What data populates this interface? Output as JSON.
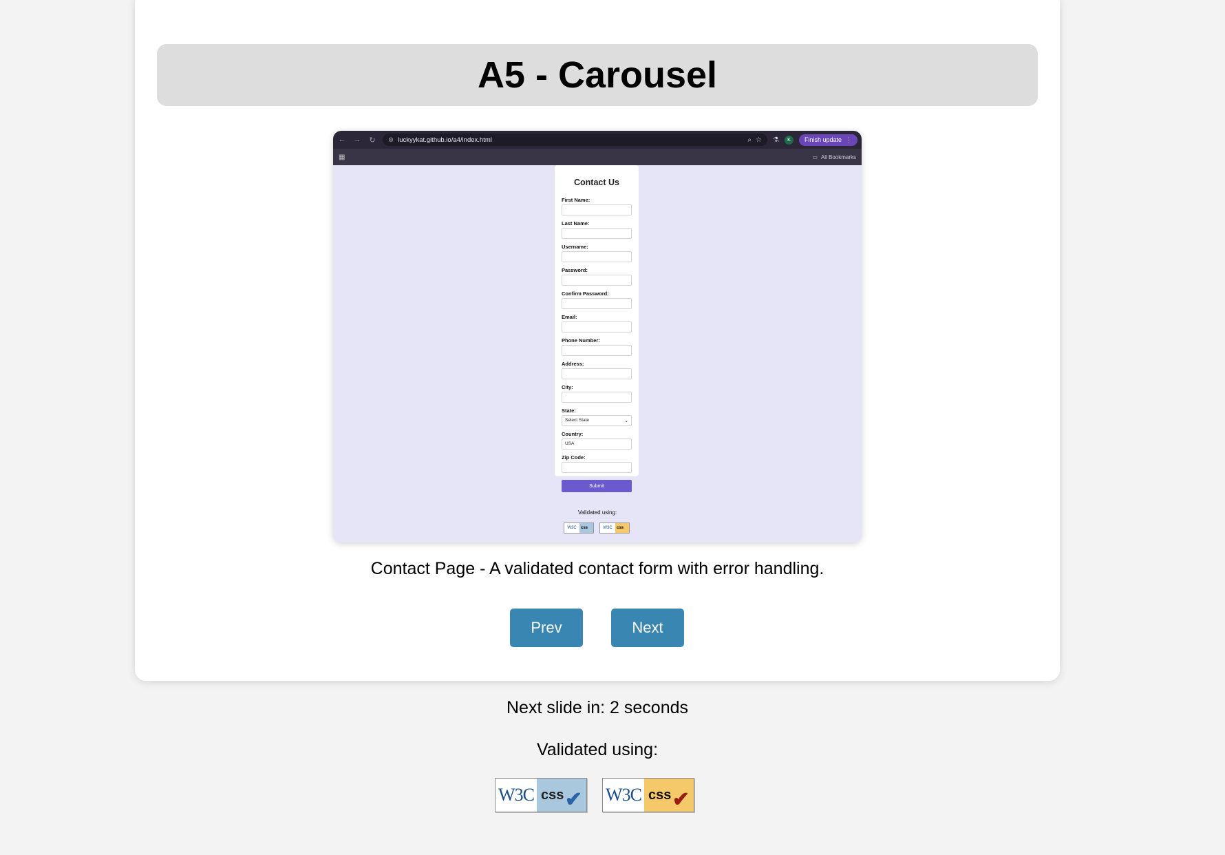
{
  "page": {
    "title": "A5 - Carousel",
    "caption": "Contact Page - A validated contact form with error handling.",
    "prev_label": "Prev",
    "next_label": "Next",
    "countdown": "Next slide in: 2 seconds",
    "validated_label": "Validated using:",
    "badges": [
      {
        "left": "W3C",
        "right": "css",
        "style": "blue"
      },
      {
        "left": "W3C",
        "right": "css",
        "style": "orange"
      }
    ]
  },
  "slide": {
    "browser": {
      "url": "luckyykat.github.io/a4/index.html",
      "finish_update": "Finish update",
      "avatar_letter": "K",
      "bookmarks_label": "All Bookmarks"
    },
    "form": {
      "heading": "Contact Us",
      "fields": [
        {
          "label": "First Name:",
          "value": ""
        },
        {
          "label": "Last Name:",
          "value": ""
        },
        {
          "label": "Username:",
          "value": ""
        },
        {
          "label": "Password:",
          "value": ""
        },
        {
          "label": "Confirm Password:",
          "value": ""
        },
        {
          "label": "Email:",
          "value": ""
        },
        {
          "label": "Phone Number:",
          "value": ""
        },
        {
          "label": "Address:",
          "value": ""
        },
        {
          "label": "City:",
          "value": ""
        },
        {
          "label": "State:",
          "value": "Select State"
        },
        {
          "label": "Country:",
          "value": "USA"
        },
        {
          "label": "Zip Code:",
          "value": ""
        }
      ],
      "submit_label": "Submit"
    },
    "validated_label": "Validated using:"
  },
  "colors": {
    "button": "#3a86b3",
    "form_submit": "#6a5acd",
    "slide_bg": "#e6e4f7"
  }
}
